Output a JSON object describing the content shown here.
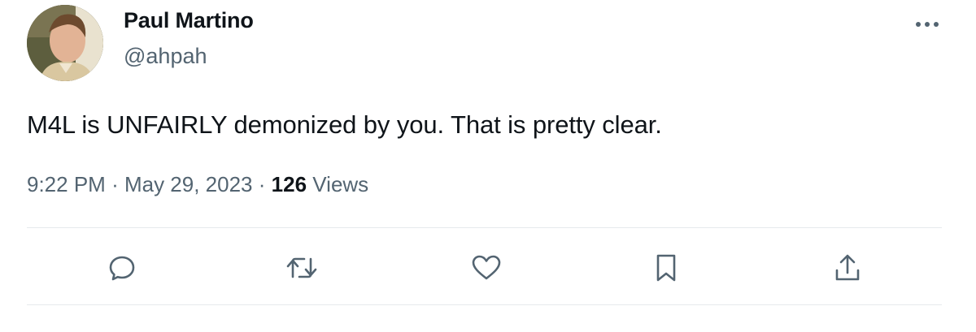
{
  "author": {
    "display_name": "Paul Martino",
    "handle": "@ahpah"
  },
  "tweet": {
    "text": "M4L is UNFAIRLY demonized by you. That is pretty clear.",
    "time": "9:22 PM",
    "separator": "·",
    "date": "May 29, 2023",
    "views_count": "126",
    "views_label": "Views"
  },
  "actions": {
    "reply": "reply-icon",
    "retweet": "retweet-icon",
    "like": "heart-icon",
    "bookmark": "bookmark-icon",
    "share": "share-icon"
  },
  "colors": {
    "primary_text": "#0f1419",
    "secondary_text": "#536471",
    "divider": "#e6eaec"
  }
}
